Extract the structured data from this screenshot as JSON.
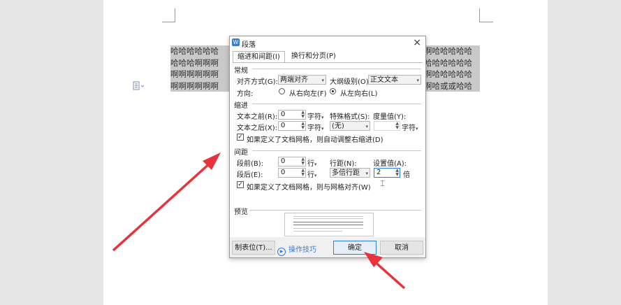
{
  "document": {
    "left_lines": [
      "哈哈哈哈哈哈",
      "哈哈哈啊啊啊",
      "啊啊啊啊啊啊",
      "啊啊啊啊啊啊"
    ],
    "right_lines": [
      "啊哈哈哈哈哈",
      "哈哈哈哈哈哈",
      "啊哈哈哈哈哈",
      "啊哈或或哈哈"
    ]
  },
  "dialog": {
    "title": "段落",
    "close_glyph": "×",
    "tabs": [
      "缩进和间距(I)",
      "换行和分页(P)"
    ],
    "general": {
      "header": "常规",
      "align_label": "对齐方式(G):",
      "align_value": "两端对齐",
      "outline_label": "大纲级别(O):",
      "outline_value": "正文文本",
      "direction_label": "方向:",
      "rtl_label": "从右向左(F)",
      "ltr_label": "从左向右(L)"
    },
    "indent": {
      "header": "缩进",
      "before_label": "文本之前(R):",
      "before_value": "0",
      "before_unit": "字符",
      "after_label": "文本之后(X):",
      "after_value": "0",
      "after_unit": "字符",
      "special_label": "特殊格式(S):",
      "special_value": "(无)",
      "measure_label": "度量值(Y):",
      "measure_value": "",
      "measure_unit": "字符",
      "auto_adjust_label": "如果定义了文档网格，则自动调整右缩进(D)"
    },
    "spacing": {
      "header": "间距",
      "before_label": "段前(B):",
      "before_value": "0",
      "before_unit": "行",
      "after_label": "段后(E):",
      "after_value": "0",
      "after_unit": "行",
      "line_label": "行距(N):",
      "line_value": "多倍行距",
      "set_label": "设置值(A):",
      "set_value": "2",
      "set_unit": "倍",
      "snap_label": "如果定义了文档网格，则与网格对齐(W)"
    },
    "preview_header": "预览",
    "footer": {
      "tabs_button": "制表位(T)...",
      "tips_link": "操作技巧",
      "ok_button": "确定",
      "cancel_button": "取消"
    }
  },
  "colors": {
    "accent": "#2f7de1",
    "annotation_arrow": "#e8323c"
  }
}
